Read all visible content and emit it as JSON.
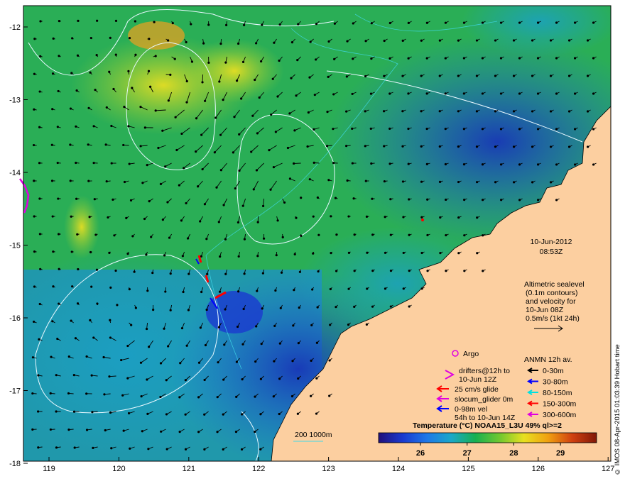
{
  "map": {
    "longitude_ticks": [
      "119",
      "120",
      "121",
      "122",
      "123",
      "124",
      "125",
      "126",
      "127"
    ],
    "latitude_ticks": [
      "-12",
      "-13",
      "-14",
      "-15",
      "-16",
      "-17",
      "-18"
    ],
    "land_color": "#fccfa0",
    "grid": false
  },
  "timestamp": {
    "date": "10-Jun-2012",
    "time": "08:53Z"
  },
  "altimetry_note": {
    "lines": [
      "Altimetric sealevel",
      "(0.1m contours)",
      "and velocity for",
      "10-Jun 08Z",
      "0.5m/s (1kt 24h)"
    ]
  },
  "legend_left": {
    "argo": "Argo",
    "drifters": [
      "drifters@12h to",
      "10-Jun 12Z"
    ],
    "glide": "25 cm/s glide",
    "slocum": "slocum_glider 0m",
    "vel": [
      "0-98m vel",
      "54h to 10-Jun 14Z"
    ],
    "argo_color": "#e000e0",
    "drifter_color": "#e000e0",
    "glide_color": "#ff0000",
    "slocum_color": "#e000e0",
    "vel_color": "#0000ff"
  },
  "legend_right": {
    "title": "ANMN 12h av.",
    "items": [
      {
        "label": "0-30m",
        "color": "#000000"
      },
      {
        "label": "30-80m",
        "color": "#0000ff"
      },
      {
        "label": "80-150m",
        "color": "#00e0e0"
      },
      {
        "label": "150-300m",
        "color": "#ff0000"
      },
      {
        "label": "300-600m",
        "color": "#e000e0"
      }
    ]
  },
  "scale_bar": {
    "label": "200 1000m"
  },
  "colorbar": {
    "title": "Temperature (°C) NOAA15_L3U 49% ql>=2",
    "ticks": [
      "26",
      "27",
      "28",
      "29"
    ],
    "stops": [
      "#20107a",
      "#1a3ad0",
      "#1e78e8",
      "#1aa8c8",
      "#18b050",
      "#70c830",
      "#e8e020",
      "#f0a010",
      "#d04010",
      "#801808"
    ]
  },
  "credit": "© IMOS 08-Apr-2015 01:03:39 Hobart time"
}
